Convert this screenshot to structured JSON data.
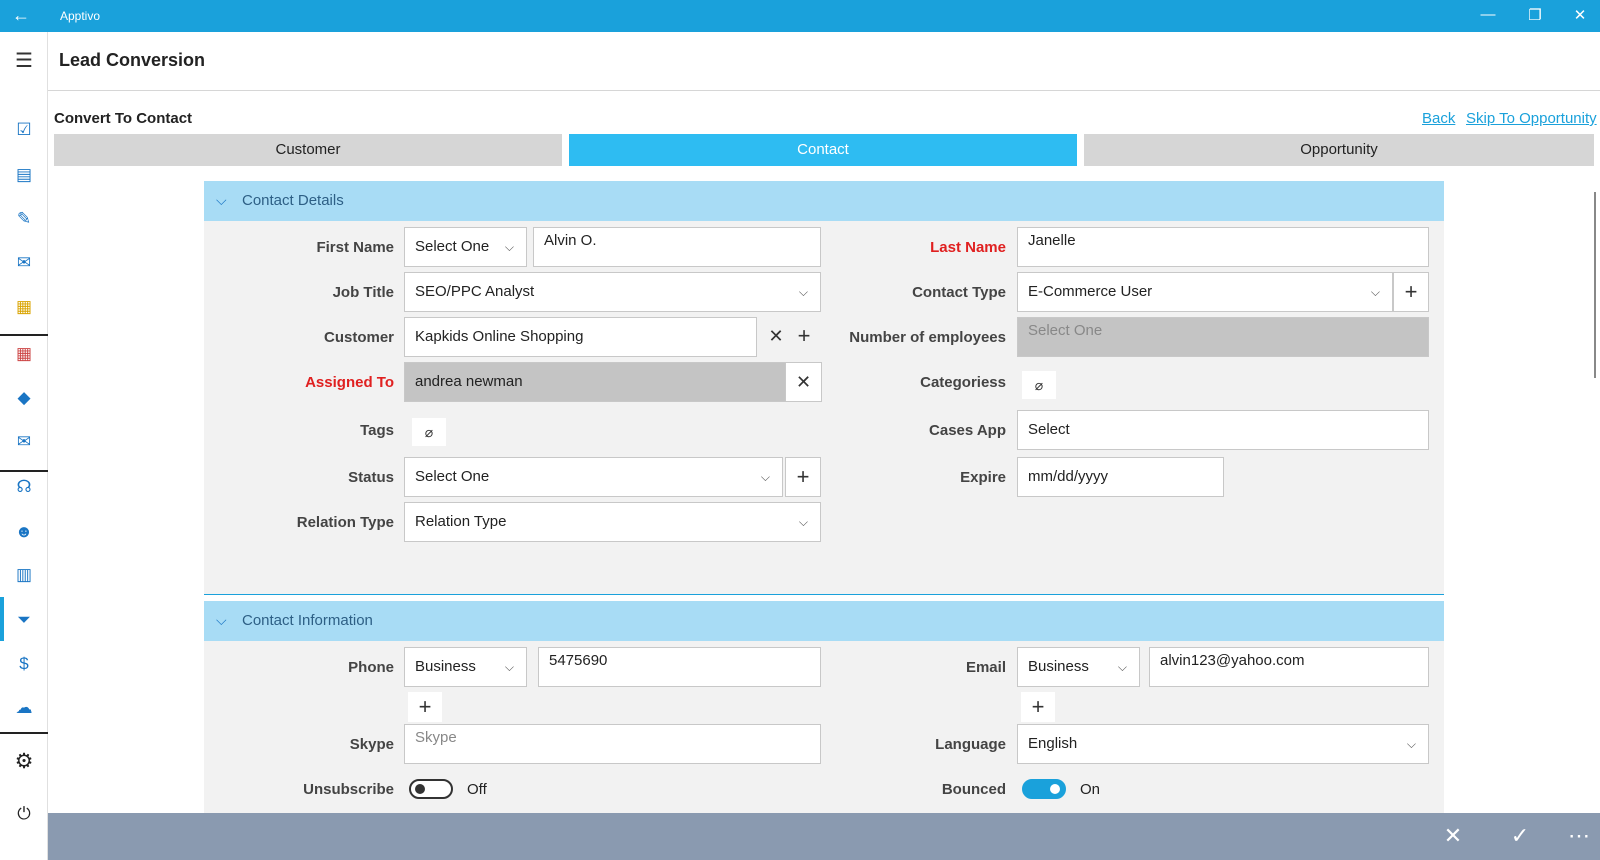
{
  "app": {
    "title": "Apptivo",
    "back_icon": "←",
    "minimize_icon": "—",
    "restore_icon": "❐",
    "close_icon": "✕"
  },
  "page": {
    "title": "Lead Conversion",
    "menu_icon": "☰"
  },
  "conversion": {
    "label": "Convert To Contact",
    "back_link": "Back",
    "skip_link": "Skip To Opportunity",
    "tabs": [
      {
        "label": "Customer",
        "active": false
      },
      {
        "label": "Contact",
        "active": true
      },
      {
        "label": "Opportunity",
        "active": false
      }
    ]
  },
  "contact_details": {
    "title": "Contact Details",
    "first_name": {
      "label": "First Name",
      "salutation": "Select One",
      "value": "Alvin O."
    },
    "last_name": {
      "label": "Last Name",
      "value": "Janelle"
    },
    "job_title": {
      "label": "Job Title",
      "value": "SEO/PPC Analyst"
    },
    "contact_type": {
      "label": "Contact Type",
      "value": "E-Commerce User"
    },
    "customer": {
      "label": "Customer",
      "value": "Kapkids Online Shopping"
    },
    "num_employees": {
      "label": "Number of employees",
      "placeholder": "Select One"
    },
    "assigned_to": {
      "label": "Assigned To",
      "value": "andrea newman"
    },
    "categories": {
      "label": "Categoriess"
    },
    "tags": {
      "label": "Tags"
    },
    "cases_app": {
      "label": "Cases App",
      "value": "Select"
    },
    "status": {
      "label": "Status",
      "value": "Select One"
    },
    "expire": {
      "label": "Expire",
      "value": "mm/dd/yyyy"
    },
    "relation_type": {
      "label": "Relation Type",
      "value": "Relation Type"
    }
  },
  "contact_info": {
    "title": "Contact Information",
    "phone": {
      "label": "Phone",
      "type": "Business",
      "value": "5475690"
    },
    "email": {
      "label": "Email",
      "type": "Business",
      "value": "alvin123@yahoo.com"
    },
    "skype": {
      "label": "Skype",
      "placeholder": "Skype"
    },
    "language": {
      "label": "Language",
      "value": "English"
    },
    "unsubscribe": {
      "label": "Unsubscribe",
      "state": "Off"
    },
    "bounced": {
      "label": "Bounced",
      "state": "On"
    }
  },
  "colors": {
    "accent": "#1aa1db",
    "active_tab": "#2ebcf2",
    "section_header": "#a8dcf5",
    "required": "#e02020",
    "bottom_bar": "#8a9ab0"
  }
}
